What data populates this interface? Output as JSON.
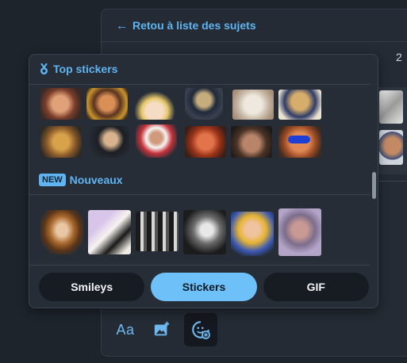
{
  "header": {
    "back_label": "Retou à liste des sujets",
    "page_number": "2"
  },
  "popover": {
    "top_section_label": "Top stickers",
    "new_badge": "NEW",
    "new_section_label": "Nouveaux",
    "top_stickers": [
      {
        "icon": "laughing-man-sticker"
      },
      {
        "icon": "laughing-man-cigar-sticker"
      },
      {
        "icon": "anime-girl-sticker"
      },
      {
        "icon": "cat-suit-sticker"
      },
      {
        "icon": "cat-paw-sticker"
      },
      {
        "icon": "cat-sailor-sticker"
      },
      {
        "icon": "frog-face-sticker"
      },
      {
        "icon": "man-dark-suit-sticker"
      },
      {
        "icon": "old-man-keffiyeh-sticker"
      },
      {
        "icon": "laughing-man-red-sticker"
      },
      {
        "icon": "smiling-man-closeup-sticker"
      },
      {
        "icon": "man-blue-glasses-sticker"
      }
    ],
    "new_stickers": [
      {
        "icon": "blonde-hair-sticker"
      },
      {
        "icon": "manga-girl-purple-sticker"
      },
      {
        "icon": "manga-panel-sticker"
      },
      {
        "icon": "manga-grayscale-sticker"
      },
      {
        "icon": "anime-blonde-boy-sticker"
      },
      {
        "icon": "man-hands-face-sticker"
      }
    ],
    "tabs": [
      {
        "label": "Smileys",
        "active": false
      },
      {
        "label": "Stickers",
        "active": true
      },
      {
        "label": "GIF",
        "active": false
      }
    ]
  },
  "toolbar": {
    "text_format_label": "Aa",
    "image_icon": "image-add-icon",
    "sticker_icon": "sticker-add-icon"
  },
  "colors": {
    "accent": "#5fb4f1",
    "active_tab": "#6ec0f8",
    "popover_bg": "#262d37",
    "page_bg": "#1e242c"
  }
}
